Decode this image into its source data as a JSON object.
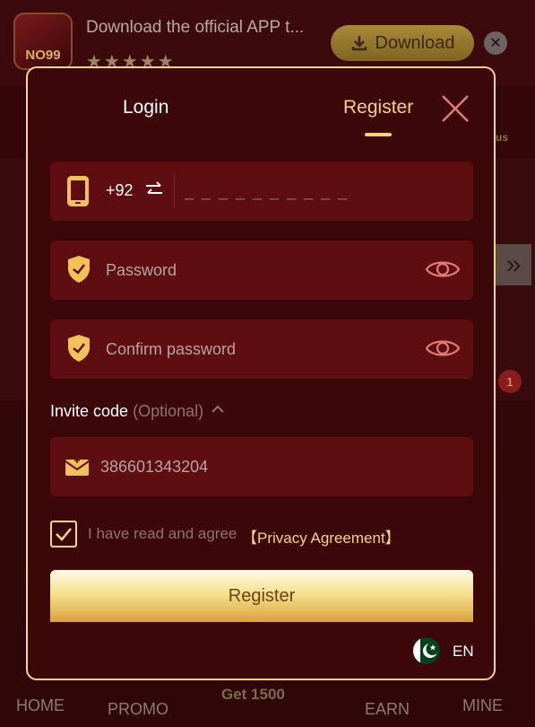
{
  "banner": {
    "app_logo_text": "NO99",
    "text": "Download the official APP t...",
    "stars": "★★★★★",
    "download_label": "Download",
    "download_icon": "download-icon",
    "close_icon": "close-circle-icon"
  },
  "background": {
    "badge_count": "1",
    "us_text": "us",
    "side_arrow": "»"
  },
  "bottom_nav": {
    "items": [
      {
        "label": "HOME"
      },
      {
        "label": "PROMO"
      },
      {
        "label": "Get 1500"
      },
      {
        "label": "EARN"
      },
      {
        "label": "MINE"
      }
    ]
  },
  "modal": {
    "tabs": {
      "login": "Login",
      "register": "Register",
      "active": "register"
    },
    "close_icon": "close-x-icon",
    "phone": {
      "country_code": "+92",
      "placeholder": "_ _ _ _ _ _ _ _ _ _",
      "icon": "phone-icon"
    },
    "password": {
      "placeholder": "Password",
      "icon": "shield-icon"
    },
    "confirm_password": {
      "placeholder": "Confirm password",
      "icon": "shield-icon"
    },
    "invite": {
      "label": "Invite code",
      "optional": "(Optional)",
      "value": "386601343204",
      "icon": "envelope-icon"
    },
    "agreement": {
      "checked": true,
      "text": "I have read and agree",
      "link": "【Privacy Agreement】"
    },
    "register_button": "Register",
    "language": {
      "code": "EN",
      "flag": "pakistan-flag-icon"
    }
  },
  "colors": {
    "accent_gold": "#f5d47b",
    "modal_bg": "#3b0708",
    "field_bg": "#5e0e10",
    "border": "#f3d78a"
  }
}
